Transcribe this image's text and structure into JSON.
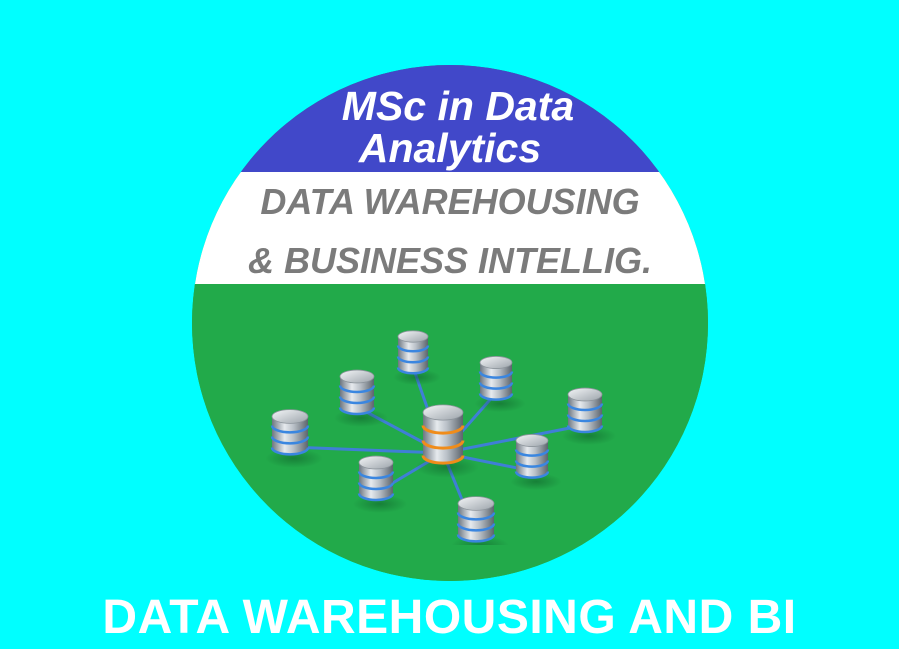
{
  "badge": {
    "program_line_1": "MSc in Data",
    "program_line_2": "Analytics",
    "course_line_1": "DATA WAREHOUSING",
    "course_line_2": "& BUSINESS INTELLIG.",
    "graphic": "database-network-icon"
  },
  "caption": "DATA WAREHOUSING AND BI",
  "colors": {
    "background": "#00ffff",
    "top_band": "#4148c9",
    "middle_band": "#ffffff",
    "bottom_band": "#22aa4a",
    "course_text": "#7b7b7b",
    "caption_text": "#ffffff"
  }
}
